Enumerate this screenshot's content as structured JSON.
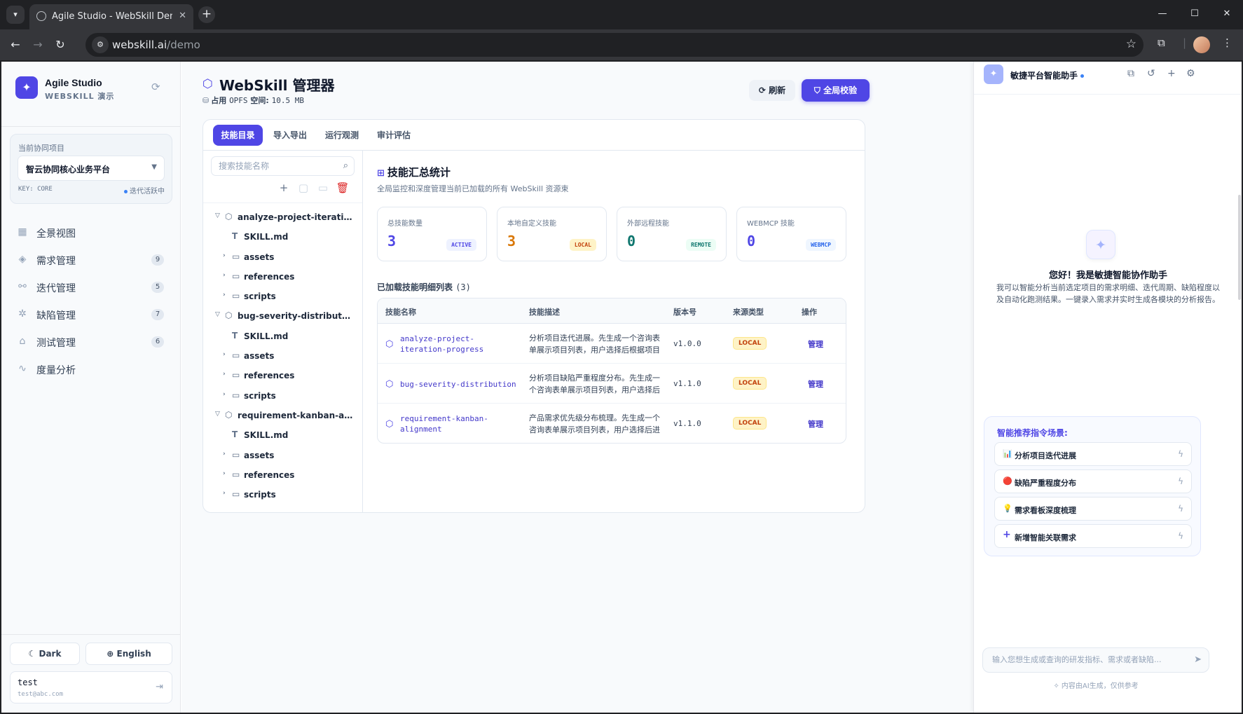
{
  "browser": {
    "tab_title": "Agile Studio - WebSkill Demo",
    "url_host": "webskill.ai",
    "url_path": "/demo"
  },
  "sidebar": {
    "brand_name": "Agile Studio",
    "brand_sub": "WEBSKILL 演示",
    "project_label": "当前协同项目",
    "project_value": "智云协同核心业务平台",
    "project_key": "KEY: CORE",
    "project_status": "迭代活跃中",
    "nav": [
      {
        "label": "全景视图",
        "icon": "grid-icon"
      },
      {
        "label": "需求管理",
        "icon": "layers-icon",
        "count": "9"
      },
      {
        "label": "迭代管理",
        "icon": "iteration-icon",
        "count": "5"
      },
      {
        "label": "缺陷管理",
        "icon": "bug-icon",
        "count": "7"
      },
      {
        "label": "测试管理",
        "icon": "test-icon",
        "count": "6"
      },
      {
        "label": "度量分析",
        "icon": "activity-icon"
      }
    ],
    "dark_label": "Dark",
    "lang_label": "English",
    "user_name": "test",
    "user_email": "test@abc.com"
  },
  "main": {
    "title": "WebSkill 管理器",
    "storage_label": "占用",
    "storage_key": "OPFS",
    "storage_space_label": "空间:",
    "storage_value": "10.5 MB",
    "refresh_label": "刷新",
    "verify_label": "全局校验",
    "tabs": [
      "技能目录",
      "导入导出",
      "运行观测",
      "审计评估"
    ],
    "search_placeholder": "搜索技能名称",
    "tree": [
      {
        "type": "root",
        "label": "analyze-project-iteration-progress"
      },
      {
        "type": "file",
        "label": "SKILL.md"
      },
      {
        "type": "dir",
        "label": "assets"
      },
      {
        "type": "dir",
        "label": "references"
      },
      {
        "type": "dir",
        "label": "scripts"
      },
      {
        "type": "root",
        "label": "bug-severity-distribution"
      },
      {
        "type": "file",
        "label": "SKILL.md"
      },
      {
        "type": "dir",
        "label": "assets"
      },
      {
        "type": "dir",
        "label": "references"
      },
      {
        "type": "dir",
        "label": "scripts"
      },
      {
        "type": "root",
        "label": "requirement-kanban-alignment"
      },
      {
        "type": "file",
        "label": "SKILL.md"
      },
      {
        "type": "dir",
        "label": "assets"
      },
      {
        "type": "dir",
        "label": "references"
      },
      {
        "type": "dir",
        "label": "scripts"
      }
    ],
    "stats_title": "技能汇总统计",
    "stats_subtitle": "全局监控和深度管理当前已加载的所有 WebSkill 资源束",
    "cards": [
      {
        "label": "总技能数量",
        "value": "3",
        "badge": "ACTIVE",
        "color": "#4f46e5",
        "badge_bg": "#eef2ff",
        "badge_fg": "#4f46e5"
      },
      {
        "label": "本地自定义技能",
        "value": "3",
        "badge": "LOCAL",
        "color": "#d97706",
        "badge_bg": "#fef3c7",
        "badge_fg": "#c2410c"
      },
      {
        "label": "外部远程技能",
        "value": "0",
        "badge": "REMOTE",
        "color": "#0f766e",
        "badge_bg": "#ecfdf5",
        "badge_fg": "#0f766e"
      },
      {
        "label": "WEBMCP 技能",
        "value": "0",
        "badge": "WEBMCP",
        "color": "#4f46e5",
        "badge_bg": "#eff6ff",
        "badge_fg": "#2563eb"
      }
    ],
    "list_title": "已加载技能明细列表",
    "list_count": "(3)",
    "table_headers": [
      "技能名称",
      "技能描述",
      "版本号",
      "来源类型",
      "操作"
    ],
    "rows": [
      {
        "name": "analyze-project-iteration-progress",
        "desc": "分析项目迭代进展。先生成一个咨询表单展示项目列表，用户选择后根据项目进行分析",
        "version": "v1.0.0",
        "source": "LOCAL",
        "action": "管理"
      },
      {
        "name": "bug-severity-distribution",
        "desc": "分析项目缺陷严重程度分布。先生成一个咨询表单展示项目列表，用户选择后进行分析",
        "version": "v1.1.0",
        "source": "LOCAL",
        "action": "管理"
      },
      {
        "name": "requirement-kanban-alignment",
        "desc": "产品需求优先级分布梳理。先生成一个咨询表单展示项目列表，用户选择后进行分析",
        "version": "v1.1.0",
        "source": "LOCAL",
        "action": "管理"
      }
    ]
  },
  "assistant": {
    "title": "敏捷平台智能助手",
    "greeting": "您好！我是敏捷智能协作助手",
    "intro": "我可以智能分析当前选定项目的需求明细、迭代周期、缺陷程度以及自动化跑测结果。一键录入需求并实时生成各模块的分析报告。",
    "suggest_title": "智能推荐指令场景:",
    "suggestions": [
      {
        "emoji": "📊",
        "label": "分析项目迭代进展"
      },
      {
        "emoji": "🔴",
        "label": "缺陷严重程度分布"
      },
      {
        "emoji": "💡",
        "label": "需求看板深度梳理"
      },
      {
        "emoji": "+",
        "label": "新增智能关联需求"
      }
    ],
    "input_placeholder": "输入您想生成或查询的研发指标、需求或者缺陷...",
    "footer": "内容由AI生成，仅供参考"
  }
}
